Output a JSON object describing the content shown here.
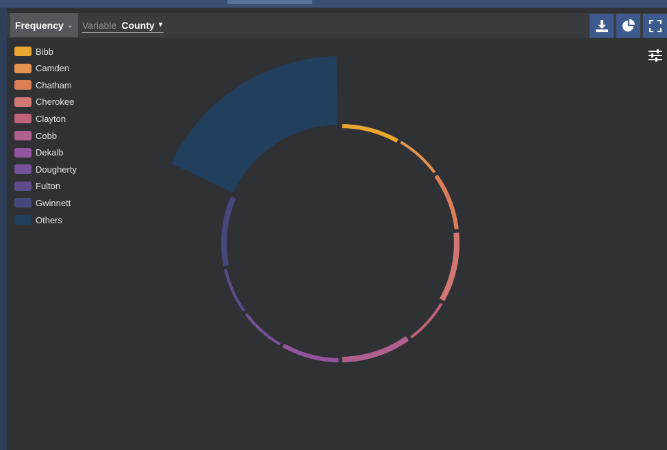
{
  "toolbar": {
    "mode_label": "Frequency",
    "variable_label": "Variable",
    "variable_value": "County"
  },
  "icons": {
    "download": "download-icon",
    "pie": "pie-chart-icon",
    "fullscreen": "fullscreen-icon",
    "settings": "sliders-icon"
  },
  "colors": {
    "toolbar_button": "#3d5a8f",
    "background": "#303134"
  },
  "chart_data": {
    "type": "pie",
    "subtype": "radial-arc",
    "legend_position": "top-left",
    "categories": [
      "Bibb",
      "Camden",
      "Chatham",
      "Cherokee",
      "Clayton",
      "Cobb",
      "Dekalb",
      "Dougherty",
      "Fulton",
      "Gwinnett",
      "Others"
    ],
    "colors": [
      "#e9a630",
      "#e39450",
      "#dc7f58",
      "#d27772",
      "#c0627a",
      "#b0608f",
      "#93549e",
      "#77529b",
      "#5e4c8d",
      "#46477b",
      "#233f5e"
    ],
    "values": [
      5,
      4,
      5,
      6,
      4,
      6,
      5,
      4,
      4,
      6,
      11
    ]
  }
}
